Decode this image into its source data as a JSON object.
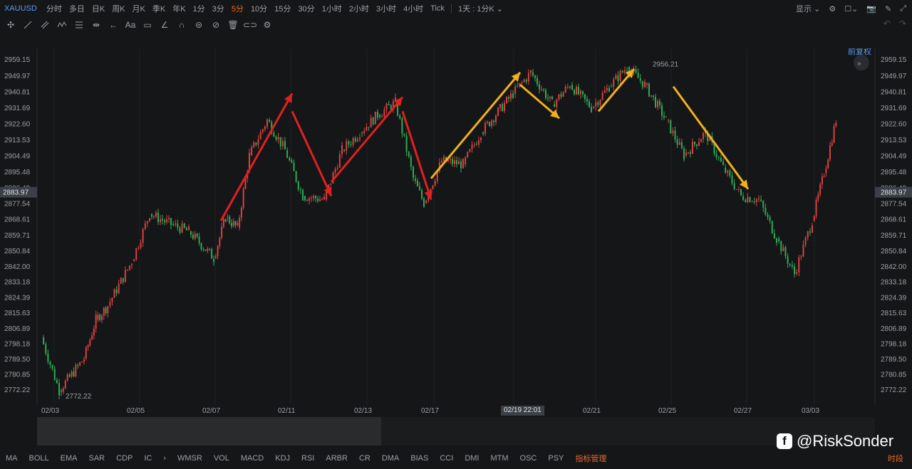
{
  "toolbar": {
    "symbol": "XAUUSD",
    "timeframes": [
      "分时",
      "多日",
      "日K",
      "周K",
      "月K",
      "季K",
      "年K",
      "1分",
      "3分",
      "5分",
      "10分",
      "15分",
      "30分",
      "1小时",
      "2小时",
      "3小时",
      "4小时",
      "Tick"
    ],
    "active_timeframe_index": 9,
    "range_label": "1天 : 1分K",
    "display_label": "显示",
    "restore_label": "前复权"
  },
  "y_axis": {
    "labels": [
      "2959.15",
      "2949.97",
      "2940.81",
      "2931.69",
      "2922.60",
      "2913.53",
      "2904.49",
      "2895.48",
      "2886.49",
      "2877.54",
      "2868.61",
      "2859.71",
      "2850.84",
      "2842.00",
      "2833.18",
      "2824.39",
      "2815.63",
      "2806.89",
      "2798.18",
      "2789.50",
      "2780.85",
      "2772.22"
    ],
    "current_price": "2883.97",
    "current_price_color": "#3b4048"
  },
  "x_axis": {
    "labels": [
      "02/03",
      "02/05",
      "02/07",
      "02/11",
      "02/13",
      "02/17",
      "02/19 22:01",
      "02/21",
      "02/25",
      "02/27",
      "03/03"
    ],
    "highlight_index": 6
  },
  "chart_data": {
    "type": "candlestick",
    "title": "",
    "ylim": [
      2768,
      2965
    ],
    "y_label_values": [
      2959.15,
      2949.97,
      2940.81,
      2931.69,
      2922.6,
      2913.53,
      2904.49,
      2895.48,
      2886.49,
      2877.54,
      2868.61,
      2859.71,
      2850.84,
      2842.0,
      2833.18,
      2824.39,
      2815.63,
      2806.89,
      2798.18,
      2789.5,
      2780.85,
      2772.22
    ],
    "price_trace": [
      [
        "02/03",
        2802
      ],
      [
        "02/03",
        2772
      ],
      [
        "02/04",
        2790
      ],
      [
        "02/04",
        2812
      ],
      [
        "02/04",
        2820
      ],
      [
        "02/05",
        2845
      ],
      [
        "02/05",
        2872
      ],
      [
        "02/06",
        2866
      ],
      [
        "02/06",
        2862
      ],
      [
        "02/07",
        2847
      ],
      [
        "02/07",
        2870
      ],
      [
        "02/07",
        2864
      ],
      [
        "02/10",
        2905
      ],
      [
        "02/10",
        2925
      ],
      [
        "02/11",
        2908
      ],
      [
        "02/11",
        2882
      ],
      [
        "02/12",
        2880
      ],
      [
        "02/12",
        2908
      ],
      [
        "02/13",
        2918
      ],
      [
        "02/13",
        2928
      ],
      [
        "02/14",
        2935
      ],
      [
        "02/14",
        2892
      ],
      [
        "02/17",
        2878
      ],
      [
        "02/17",
        2902
      ],
      [
        "02/18",
        2900
      ],
      [
        "02/18",
        2918
      ],
      [
        "02/19",
        2940
      ],
      [
        "02/19",
        2952
      ],
      [
        "02/20",
        2934
      ],
      [
        "02/20",
        2945
      ],
      [
        "02/21",
        2932
      ],
      [
        "02/21",
        2944
      ],
      [
        "02/24",
        2955
      ],
      [
        "02/24",
        2945
      ],
      [
        "02/25",
        2925
      ],
      [
        "02/25",
        2905
      ],
      [
        "02/26",
        2918
      ],
      [
        "02/26",
        2898
      ],
      [
        "02/27",
        2882
      ],
      [
        "02/27",
        2880
      ],
      [
        "02/28",
        2858
      ],
      [
        "02/28",
        2838
      ],
      [
        "03/03",
        2868
      ],
      [
        "03/03",
        2895
      ],
      [
        "03/03",
        2925
      ]
    ],
    "high_label": "2956.21",
    "low_label": "2772.22",
    "up_color": "#d94141",
    "down_color": "#2eaa57",
    "arrows": [
      {
        "color": "#e02020",
        "from": [
          "02/07",
          2868
        ],
        "to": [
          "02/11",
          2940
        ]
      },
      {
        "color": "#e02020",
        "from": [
          "02/11",
          2930
        ],
        "to": [
          "02/12",
          2882
        ]
      },
      {
        "color": "#e02020",
        "from": [
          "02/12",
          2890
        ],
        "to": [
          "02/14",
          2938
        ]
      },
      {
        "color": "#e02020",
        "from": [
          "02/14",
          2930
        ],
        "to": [
          "02/17",
          2880
        ]
      },
      {
        "color": "#f0b020",
        "from": [
          "02/17",
          2892
        ],
        "to": [
          "02/19",
          2952
        ]
      },
      {
        "color": "#f0b020",
        "from": [
          "02/19",
          2945
        ],
        "to": [
          "02/20",
          2926
        ]
      },
      {
        "color": "#f0b020",
        "from": [
          "02/21",
          2930
        ],
        "to": [
          "02/24",
          2954
        ]
      },
      {
        "color": "#f0b020",
        "from": [
          "02/25",
          2944
        ],
        "to": [
          "02/27",
          2886
        ]
      }
    ]
  },
  "indicators": {
    "items": [
      "MA",
      "BOLL",
      "EMA",
      "SAR",
      "CDP",
      "IC",
      "WMSR",
      "VOL",
      "MACD",
      "KDJ",
      "RSI",
      "ARBR",
      "CR",
      "DMA",
      "BIAS",
      "CCI",
      "DMI",
      "MTM",
      "OSC",
      "PSY",
      "指标管理"
    ],
    "manage_index": 20,
    "right_label": "时段"
  },
  "watermark": {
    "text": "@RiskSonder",
    "icon": "facebook-icon"
  }
}
